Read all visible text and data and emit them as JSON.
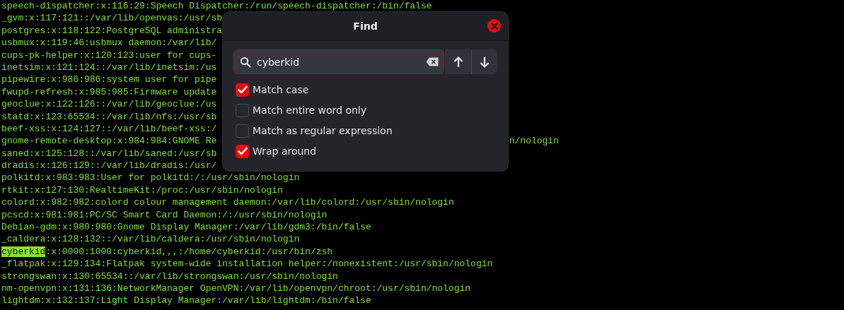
{
  "terminal": {
    "lines": [
      {
        "text": "speech-dispatcher:x:116:29:Speech Dispatcher:/run/speech-dispatcher:/bin/false"
      },
      {
        "text": "_gvm:x:117:121::/var/lib/openvas:/usr/sb"
      },
      {
        "text": "postgres:x:118:122:PostgreSQL administra"
      },
      {
        "text": "usbmux:x:119:46:usbmux daemon:/var/lib/"
      },
      {
        "text": "cups-pk-helper:x:120:123:user for cups-"
      },
      {
        "text": "inetsim:x:121:124::/var/lib/inetsim:/us"
      },
      {
        "text": "pipewire:x:986:986:system user for pipe"
      },
      {
        "text": "fwupd-refresh:x:985:985:Firmware update"
      },
      {
        "text": "geoclue:x:122:126::/var/lib/geoclue:/us"
      },
      {
        "text": "statd:x:123:65534::/var/lib/nfs:/usr/sb"
      },
      {
        "text": "beef-xss:x:124:127::/var/lib/beef-xss:/"
      },
      {
        "text": "gnome-remote-desktop:x:984:984:GNOME Re",
        "tail": "n/nologin"
      },
      {
        "text": "saned:x:125:128::/var/lib/saned:/usr/sb"
      },
      {
        "text": "dradis:x:126:129::/var/lib/dradis:/usr/"
      },
      {
        "text": "polkitd:x:983:983:User for polkitd:/:/usr/sbin/nologin"
      },
      {
        "text": "rtkit:x:127:130:RealtimeKit:/proc:/usr/sbin/nologin"
      },
      {
        "text": "colord:x:982:982:colord colour management daemon:/var/lib/colord:/usr/sbin/nologin"
      },
      {
        "text": "pcscd:x:981:981:PC/SC Smart Card Daemon:/:/usr/sbin/nologin"
      },
      {
        "text": "Debian-gdm:x:980:980:Gnome Display Manager:/var/lib/gdm3:/bin/false"
      },
      {
        "text": "_caldera:x:128:132::/var/lib/caldera:/usr/sbin/nologin"
      },
      {
        "match": "cyberkid",
        "text": ":x:0000:1000:cyberkid,,,:/home/cyberkid:/usr/bin/zsh"
      },
      {
        "text": "_flatpak:x:129:134:Flatpak system-wide installation helper:/nonexistent:/usr/sbin/nologin"
      },
      {
        "text": "strongswan:x:130:65534::/var/lib/strongswan:/usr/sbin/nologin"
      },
      {
        "text": "nm-openvpn:x:131:136:NetworkManager OpenVPN:/var/lib/openvpn/chroot:/usr/sbin/nologin"
      },
      {
        "text": "lightdm:x:132:137:Light Display Manager:/var/lib/lightdm:/bin/false"
      }
    ]
  },
  "find_dialog": {
    "title": "Find",
    "search": {
      "value": "cyberkid"
    },
    "options": [
      {
        "label": "Match case",
        "checked": true
      },
      {
        "label": "Match entire word only",
        "checked": false
      },
      {
        "label": "Match as regular expression",
        "checked": false
      },
      {
        "label": "Wrap around",
        "checked": true
      }
    ]
  }
}
